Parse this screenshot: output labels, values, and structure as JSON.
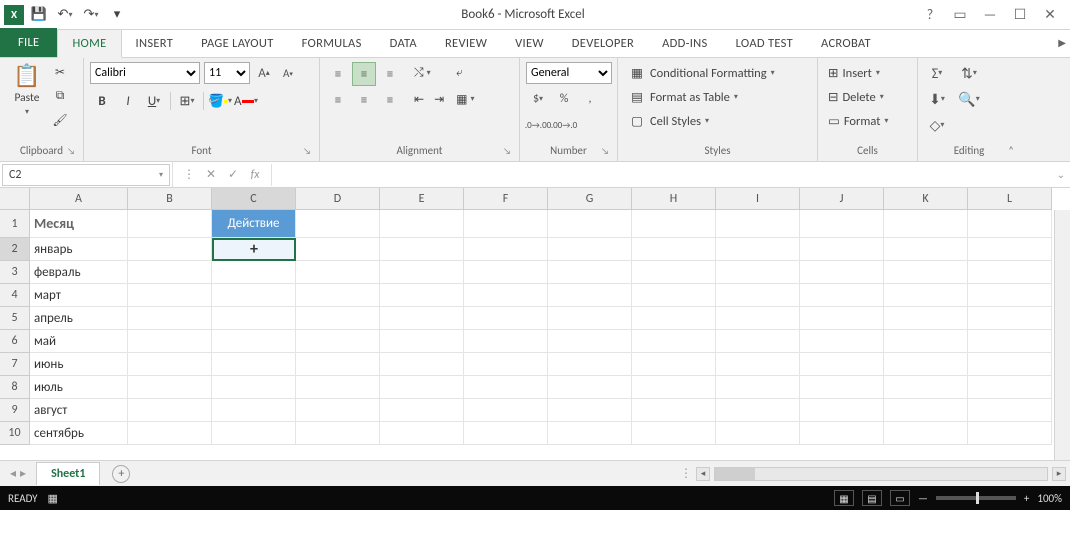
{
  "title": "Book6 - Microsoft Excel",
  "qat": {
    "save": "💾",
    "undo": "↶",
    "redo": "↷"
  },
  "win": {
    "help": "?",
    "opts": "▭",
    "min": "—",
    "max": "☐",
    "close": "✕"
  },
  "tabs": [
    "FILE",
    "HOME",
    "INSERT",
    "PAGE LAYOUT",
    "FORMULAS",
    "DATA",
    "REVIEW",
    "VIEW",
    "DEVELOPER",
    "ADD-INS",
    "LOAD TEST",
    "ACROBAT"
  ],
  "ribbon": {
    "clipboard": {
      "label": "Clipboard",
      "paste": "Paste"
    },
    "font": {
      "label": "Font",
      "name": "Calibri",
      "size": "11"
    },
    "alignment": {
      "label": "Alignment",
      "wrap": "",
      "merge": ""
    },
    "number": {
      "label": "Number",
      "format": "General"
    },
    "styles": {
      "label": "Styles",
      "cond": "Conditional Formatting",
      "table": "Format as Table",
      "cell": "Cell Styles"
    },
    "cells": {
      "label": "Cells",
      "insert": "Insert",
      "delete": "Delete",
      "format": "Format"
    },
    "editing": {
      "label": "Editing"
    }
  },
  "namebox": "C2",
  "columns": [
    "A",
    "B",
    "C",
    "D",
    "E",
    "F",
    "G",
    "H",
    "I",
    "J",
    "K",
    "L"
  ],
  "rows": [
    "1",
    "2",
    "3",
    "4",
    "5",
    "6",
    "7",
    "8",
    "9",
    "10"
  ],
  "selected_col": 2,
  "selected_row": 1,
  "cells": {
    "A1": "Месяц",
    "C1": "Действие",
    "A2": "январь",
    "A3": "февраль",
    "A4": "март",
    "A5": "апрель",
    "A6": "май",
    "A7": "июнь",
    "A8": "июль",
    "A9": "август",
    "A10": "сентябрь"
  },
  "active_cell_content": "+",
  "sheet": {
    "name": "Sheet1"
  },
  "status": {
    "ready": "READY",
    "zoom": "100%"
  }
}
